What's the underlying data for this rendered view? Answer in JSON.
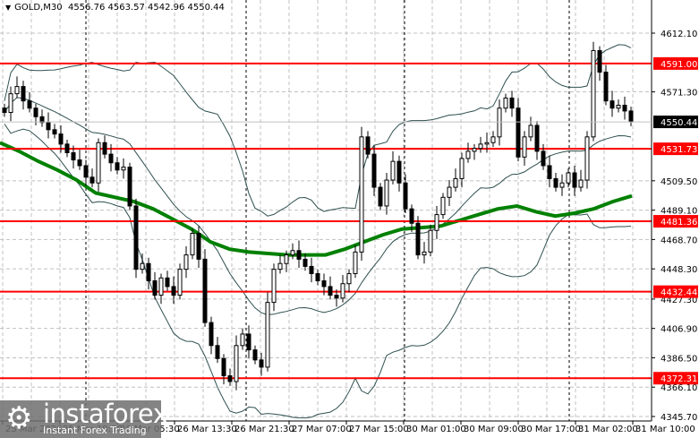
{
  "header": {
    "symbol": "GOLD,M30",
    "ohlc": "4556.76 4563.57 4542.96 4550.44"
  },
  "logo": {
    "name": "instaforex",
    "tagline": "Instant Forex Trading"
  },
  "chart_data": {
    "type": "candlestick",
    "title": "GOLD,M30",
    "y_ticks": [
      4612.1,
      4591.5,
      4571.3,
      4550.9,
      4530.5,
      4509.5,
      4489.1,
      4468.7,
      4448.3,
      4427.3,
      4406.9,
      4386.5,
      4366.1,
      4345.7
    ],
    "y_tick_labels": [
      "4612.10",
      "4571.30",
      "4509.50",
      "4489.10",
      "4468.70",
      "4448.30",
      "4427.30",
      "4406.90",
      "4386.50",
      "4366.10",
      "4345.70"
    ],
    "y_tick_values": [
      4612.1,
      4571.3,
      4509.5,
      4489.1,
      4468.7,
      4448.3,
      4427.3,
      4406.9,
      4386.5,
      4366.1,
      4345.7
    ],
    "ylim": [
      4345.7,
      4612.1
    ],
    "x_tick_labels": [
      "25 Mar 2026",
      "25 Mar 19:30",
      "26 Mar 05:30",
      "26 Mar 13:30",
      "26 Mar 21:30",
      "27 Mar 07:00",
      "27 Mar 15:00",
      "30 Mar 01:00",
      "30 Mar 09:00",
      "30 Mar 17:00",
      "31 Mar 02:00",
      "31 Mar 10:00"
    ],
    "current_price": {
      "value": 4550.44,
      "label": "4550.44",
      "color": "#000000"
    },
    "levels": [
      {
        "value": 4591.0,
        "label": "4591.00"
      },
      {
        "value": 4531.73,
        "label": "4531.73"
      },
      {
        "value": 4481.36,
        "label": "4481.36"
      },
      {
        "value": 4432.44,
        "label": "4432.44"
      },
      {
        "value": 4372.31,
        "label": "4372.31"
      }
    ],
    "level_color": "#ff0000",
    "ma_color": "#008000",
    "band_color": "#2f4f4f",
    "close": [
      4557,
      4570,
      4575,
      4565,
      4560,
      4554,
      4550,
      4545,
      4542,
      4535,
      4529,
      4524,
      4520,
      4512,
      4508,
      4536,
      4528,
      4522,
      4517,
      4519,
      4492,
      4448,
      4452,
      4440,
      4430,
      4442,
      4436,
      4430,
      4448,
      4458,
      4473,
      4455,
      4411,
      4395,
      4386,
      4374,
      4370,
      4395,
      4403,
      4392,
      4385,
      4380,
      4425,
      4448,
      4452,
      4458,
      4461,
      4455,
      4450,
      4445,
      4440,
      4436,
      4430,
      4428,
      4438,
      4445,
      4460,
      4540,
      4528,
      4505,
      4492,
      4510,
      4523,
      4508,
      4490,
      4480,
      4458,
      4460,
      4475,
      4486,
      4498,
      4505,
      4511,
      4525,
      4530,
      4532,
      4535,
      4536,
      4540,
      4560,
      4567,
      4560,
      4526,
      4540,
      4548,
      4530,
      4520,
      4511,
      4505,
      4508,
      4515,
      4505,
      4510,
      4540,
      4600,
      4585,
      4565,
      4560,
      4562,
      4558,
      4550.44
    ],
    "ma": [
      4536,
      4530,
      4523,
      4517,
      4510,
      4501,
      4498,
      4495,
      4490,
      4483,
      4476,
      4467,
      4462,
      4460,
      4459,
      4458,
      4458,
      4458,
      4462,
      4467,
      4472,
      4476,
      4477,
      4478,
      4482,
      4486,
      4490,
      4492,
      4488,
      4485,
      4487,
      4490,
      4495,
      4499
    ]
  }
}
